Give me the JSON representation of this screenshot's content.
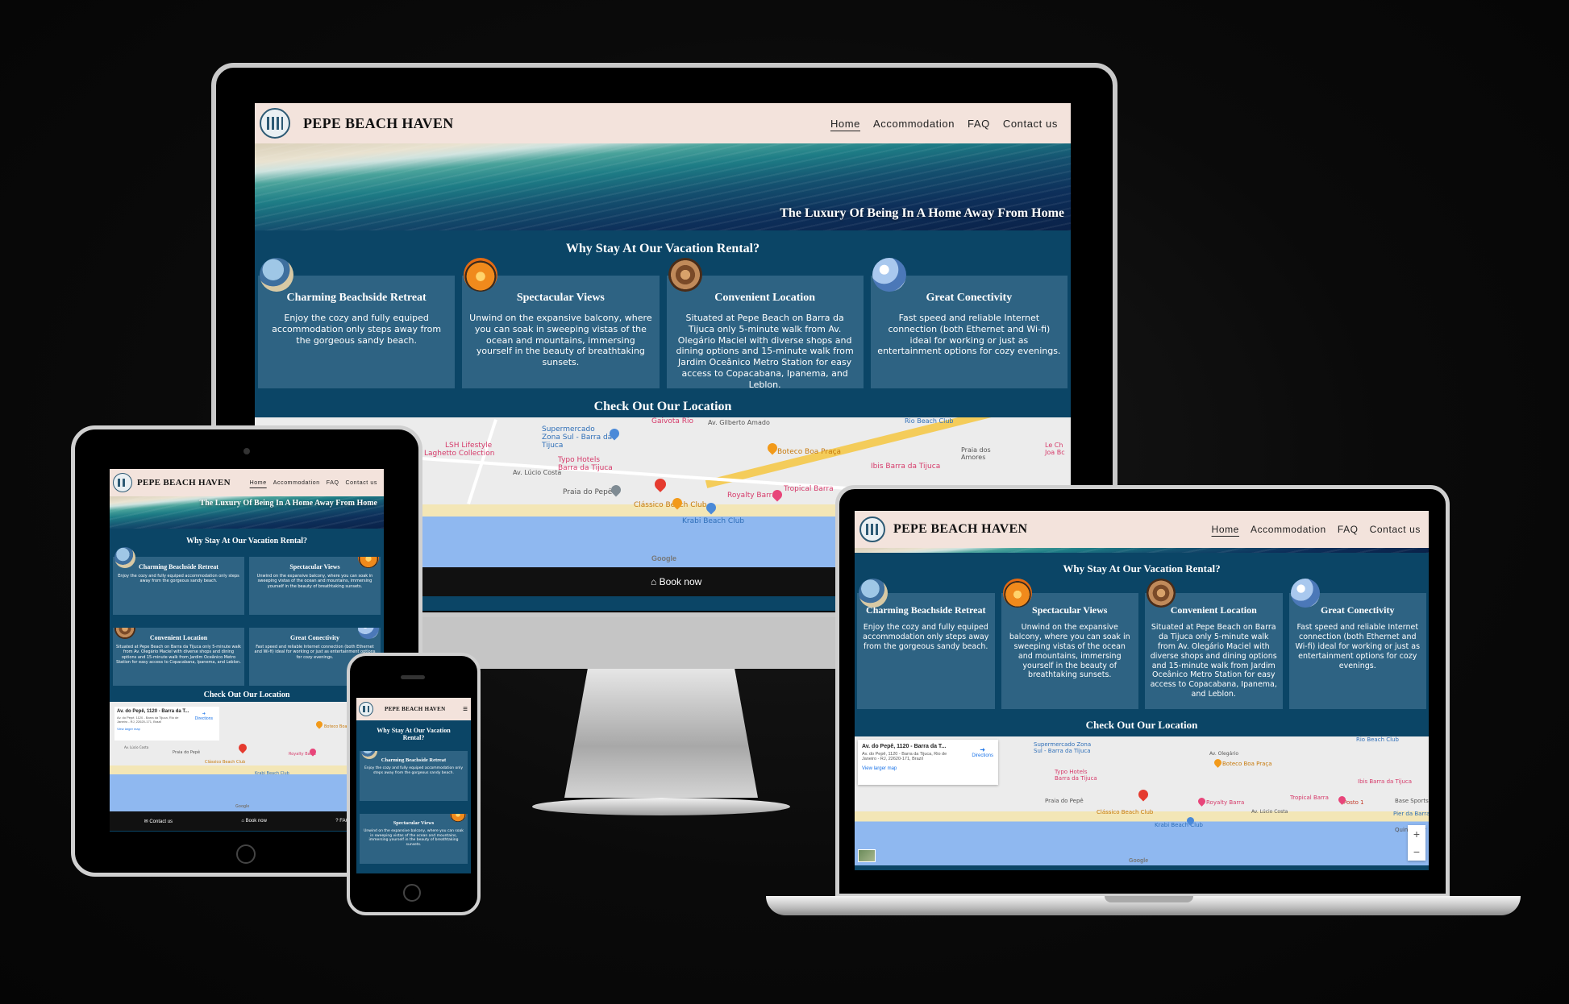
{
  "site": {
    "brand": "PEPE BEACH HAVEN",
    "nav": [
      "Home",
      "Accommodation",
      "FAQ",
      "Contact us"
    ],
    "hero_tagline": "The Luxury Of Being In A Home Away From Home",
    "why_title": "Why Stay At Our Vacation Rental?",
    "location_title": "Check Out Our Location",
    "book_now": "Book now",
    "contact_us": "Contact us",
    "faq": "FAQ",
    "menu_icon": "hamburger-menu-icon"
  },
  "features": [
    {
      "title": "Charming Beachside Retreat",
      "icon": "beach-photo",
      "text": "Enjoy the cozy and fully equiped accommodation only steps away from the gorgeous sandy beach."
    },
    {
      "title": "Spectacular Views",
      "icon": "sunset-photo",
      "text": "Unwind on the expansive balcony, where you can soak in sweeping vistas of the ocean and mountains, immersing yourself in the beauty of breathtaking sunsets."
    },
    {
      "title": "Convenient Location",
      "icon": "restaurant-photo",
      "text": "Situated at Pepe Beach on Barra da Tijuca only 5-minute walk from Av. Olegário Maciel with diverse shops and dining options and 15-minute walk from Jardim Oceânico Metro Station for easy access to Copacabana, Ipanema, and Leblon."
    },
    {
      "title": "Great Conectivity",
      "icon": "globe-photo",
      "text": "Fast speed and reliable Internet connection (both Ethernet and Wi-fi) ideal for working or just as entertainment options for cozy evenings."
    }
  ],
  "map": {
    "place_title": "Av. do Pepê, 1120 - Barra da T...",
    "place_address": "Av. do Pepê, 1120 - Barra da Tijuca, Rio de Janeiro - RJ, 22620-171, Brazil",
    "directions": "Directions",
    "view_larger": "View larger map",
    "zoom_in": "+",
    "zoom_out": "−",
    "google": "Google",
    "labels": {
      "gaivota": "Gaivota Rio",
      "gilberto": "Av. Gilberto Amado",
      "supermercado": "Supermercado Zona Sul - Barra da Tijuca",
      "lsh": "LSH Lifestyle",
      "laghetto": "Laghetto Collection",
      "typo": "Typo Hotels Barra da Tijuca",
      "praia_pepe": "Praia do Pepê",
      "classico": "Clássico Beach Club",
      "krabi": "Krabi Beach Club",
      "boteco": "Boteco Boa Praça",
      "royalty": "Royalty Barra",
      "tropical": "Tropical Barra",
      "ibis": "Ibis Barra da Tijuca",
      "lucio_costa": "Av. Lúcio Costa",
      "praia_amores": "Praia dos Amores",
      "posto": "Posto 1",
      "base": "Base Sports",
      "pier": "Pier da Barra",
      "quinta": "Quinta Mar",
      "olegario": "Av. Olegário",
      "rio_beach": "Rio Beach Club",
      "le_ch": "Le Ch Joa Bc"
    }
  }
}
